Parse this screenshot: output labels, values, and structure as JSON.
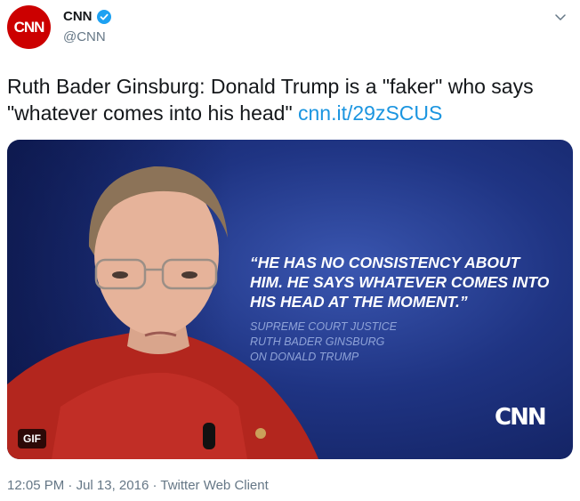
{
  "account": {
    "avatar_text": "CNN",
    "display_name": "CNN",
    "handle": "@CNN",
    "verified_icon": "verified-badge-icon",
    "menu_icon": "chevron-down-icon"
  },
  "tweet": {
    "text": "Ruth Bader Ginsburg: Donald Trump is a \"faker\" who says \"whatever comes into his head\" ",
    "link": "cnn.it/29zSCUS"
  },
  "media": {
    "quote": "“He has no consistency about him. He says whatever comes into his head at the moment.”",
    "attribution": [
      "SUPREME COURT JUSTICE",
      "RUTH BADER GINSBURG",
      "ON DONALD TRUMP"
    ],
    "logo": "CNN",
    "badge": "GIF"
  },
  "footer": {
    "time": "12:05 PM",
    "date": "Jul 13, 2016",
    "client": "Twitter Web Client",
    "separator": " · "
  },
  "colors": {
    "brand_red": "#cc0000",
    "link_blue": "#1b95e0",
    "verified_blue": "#1da1f2",
    "muted_gray": "#657786"
  }
}
